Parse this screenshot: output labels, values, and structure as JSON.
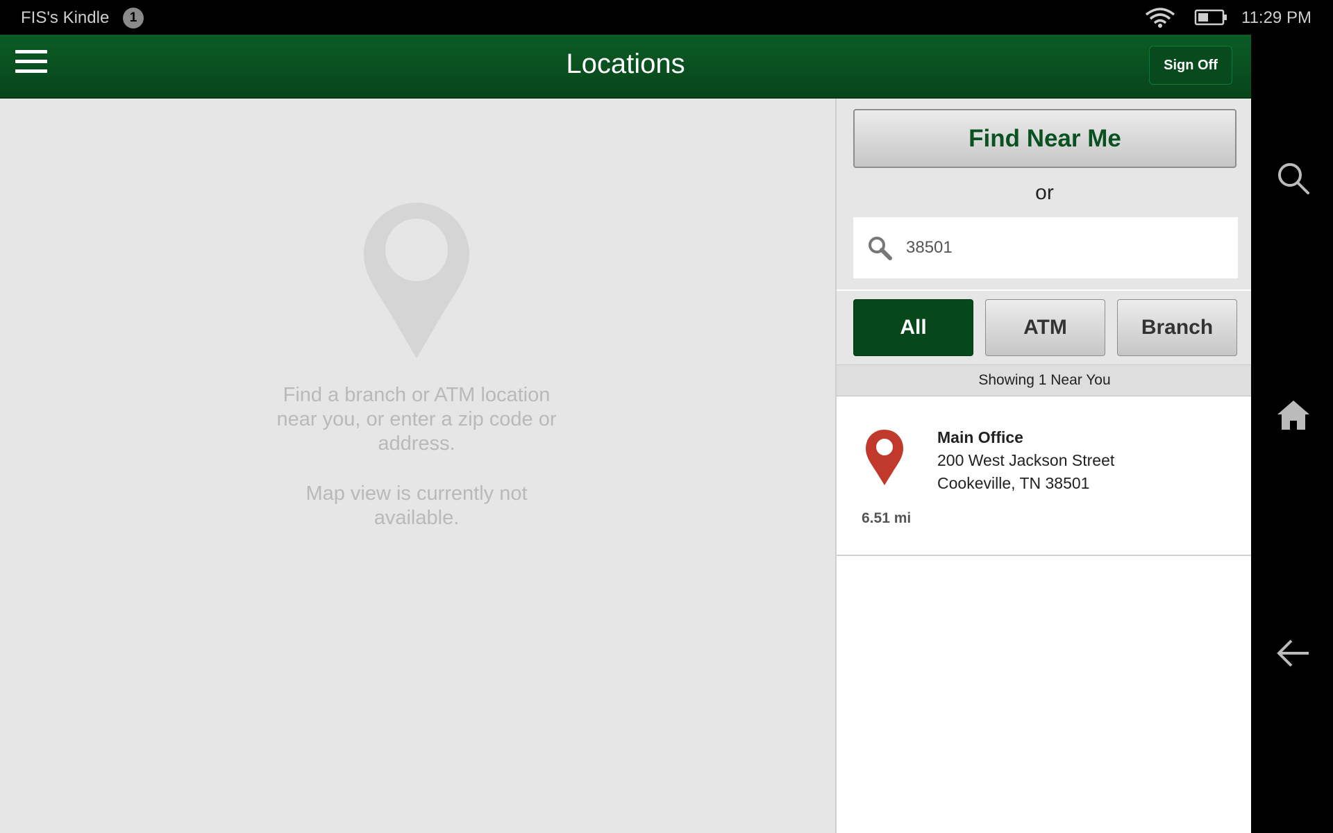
{
  "status_bar": {
    "device_name": "FIS's Kindle",
    "notification_count": "1",
    "time": "11:29 PM",
    "icons": [
      "wifi-icon",
      "battery-icon"
    ]
  },
  "header": {
    "title": "Locations",
    "sign_off_label": "Sign Off",
    "menu_icon": "hamburger-menu-icon"
  },
  "map": {
    "message_line1": "Find a branch or ATM location near you, or enter a zip code or address.",
    "message_line2": "Map view is currently not available."
  },
  "panel": {
    "find_near_me_label": "Find Near Me",
    "or_label": "or",
    "search": {
      "value": "38501",
      "icon": "search-icon"
    },
    "filters": [
      {
        "label": "All",
        "active": true
      },
      {
        "label": "ATM",
        "active": false
      },
      {
        "label": "Branch",
        "active": false
      }
    ],
    "results_label": "Showing 1 Near You",
    "locations": [
      {
        "name": "Main Office",
        "address_line1": "200 West Jackson Street",
        "address_line2": "Cookeville, TN 38501",
        "distance": "6.51 mi"
      }
    ]
  },
  "nav_bar": {
    "icons": [
      "search-icon",
      "home-icon",
      "back-arrow-icon"
    ]
  },
  "colors": {
    "header_green": "#07451b",
    "active_filter": "#06481c",
    "pin_red": "#c0392b",
    "background": "#e6e6e6"
  }
}
